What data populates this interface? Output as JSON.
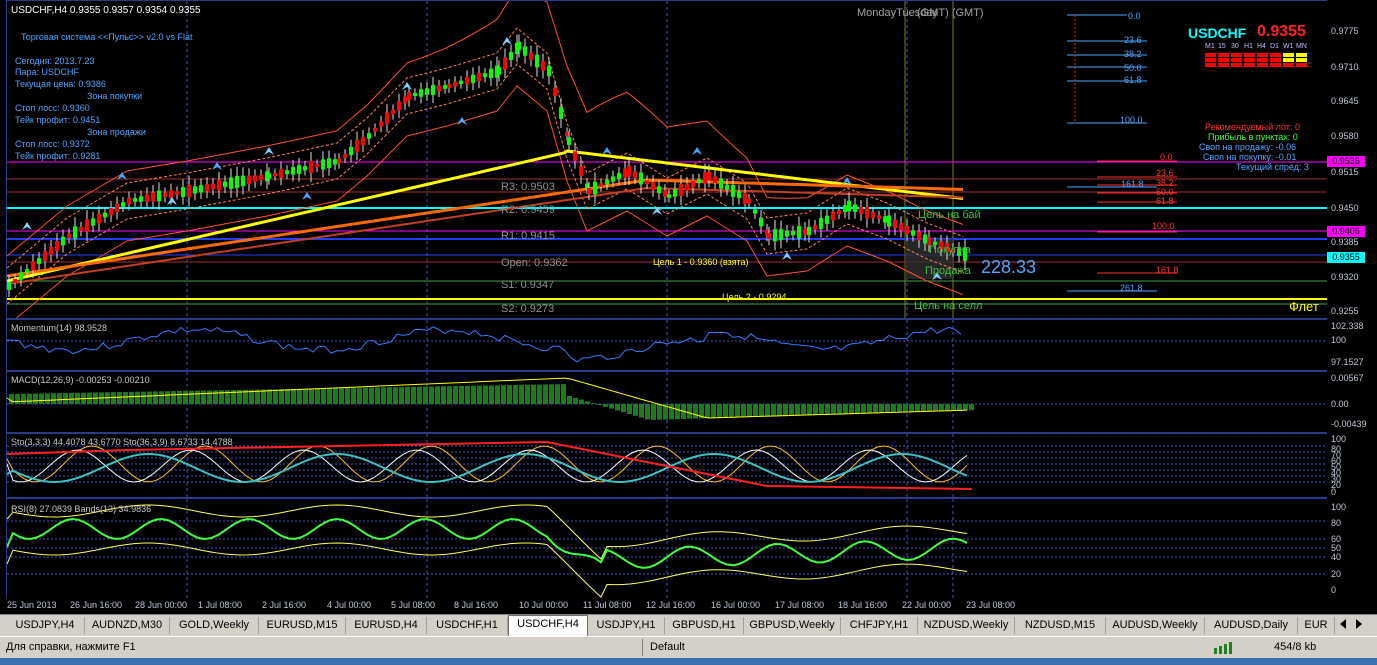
{
  "chart": {
    "header": "USDCHF,H4  0.9355 0.9357 0.9354 0.9355",
    "day_label": "MondayTuesday",
    "gmt_label": "(GMT)  (GMT)",
    "symbol": "USDCHF",
    "price": "0.9355",
    "timeframes": [
      "M1",
      "15",
      "30",
      "H1",
      "H4",
      "D1",
      "W1",
      "MN"
    ],
    "info_panel": {
      "title": "Торговая система <<Пульс>> v2.0 vs Flat",
      "lines": [
        "Сегодня:  2013.7.23",
        "Пара:  USDCHF",
        "Текущая цена: 0.9386",
        "Зона покупки",
        "Стоп лосс:  0.9360",
        "Тейк профит:  0.9451",
        "Зона продажи",
        "Стоп лосс:  0.9372",
        "Тейк профит:  0.9281"
      ]
    },
    "right_info": [
      "Рекомендуемый лот: 0",
      "Прибыль в пунктах: 0",
      "Своп на продажу: -0.06",
      "Своп на покупку: -0.01",
      "Текущий спред: 3"
    ],
    "pivots": [
      "R3: 0.9503",
      "R2: 0.9459",
      "R1: 0.9415",
      "Open: 0.9362",
      "S1: 0.9347",
      "S2: 0.9273"
    ],
    "targets": [
      "Цель 1 - 0.9360 (взята)",
      "Цель 2 - 0.9294"
    ],
    "zone_labels": [
      "Цель на бай",
      "Покупка",
      "Продажа",
      "Цель на селл"
    ],
    "big_number": "228.33",
    "flat_label": "Флет",
    "fib_top": [
      "0.0",
      "23.6",
      "38.2",
      "50.0",
      "61.8",
      "100.0"
    ],
    "fib_mid": [
      "0.0",
      "23.6",
      "38.2",
      "50.0",
      "61.8",
      "100.0",
      "161.8",
      "261.8",
      "161.8"
    ],
    "price_scale": [
      "0.9775",
      "0.9710",
      "0.9645",
      "0.9580",
      "0.9515",
      "0.9450",
      "0.9385",
      "0.9320",
      "0.9255"
    ],
    "price_tags": [
      {
        "v": "0.9536",
        "c": "#ff00ff"
      },
      {
        "v": "0.9406",
        "c": "#ff00ff"
      },
      {
        "v": "0.9355",
        "c": "#00ffff"
      }
    ],
    "colors": {
      "bull": "#00ff00",
      "bear": "#ff0000",
      "ma_yellow": "#ffff00",
      "ma_orange": "#ff6a00",
      "grid": "#2a3a88"
    }
  },
  "indicators": {
    "momentum": {
      "label": "Momentum(14) 98.9528",
      "scale": [
        "102.338",
        "100",
        "97.1527"
      ]
    },
    "macd": {
      "label": "MACD(12,26,9) -0.00253 -0.00210",
      "scale": [
        "0.00567",
        "0.00",
        "-0.00439"
      ]
    },
    "stoch": {
      "label": "Sto(3,3,3) 44.4078 43.6770  Sto(36,3,9) 8.6733 14.4788",
      "scale": [
        "100",
        "80",
        "70",
        "60",
        "50",
        "40",
        "30",
        "20",
        "0"
      ]
    },
    "rsi": {
      "label": "RSI(8) 27.0839  Bands(13) 34.9836",
      "scale": [
        "100",
        "80",
        "60",
        "50",
        "40",
        "20",
        "0"
      ]
    }
  },
  "time_axis": [
    "25 Jun 2013",
    "26 Jun 16:00",
    "28 Jun 00:00",
    "1 Jul 08:00",
    "2 Jul 16:00",
    "4 Jul 00:00",
    "5 Jul 08:00",
    "8 Jul 16:00",
    "10 Jul 00:00",
    "11 Jul 08:00",
    "12 Jul 16:00",
    "16 Jul 00:00",
    "17 Jul 08:00",
    "18 Jul 16:00",
    "22 Jul 00:00",
    "23 Jul 08:00"
  ],
  "tabs": [
    "USDJPY,H4",
    "AUDNZD,M30",
    "GOLD,Weekly",
    "EURUSD,M15",
    "EURUSD,H4",
    "USDCHF,H1",
    "USDCHF,H4",
    "USDJPY,H1",
    "GBPUSD,H1",
    "GBPUSD,Weekly",
    "CHFJPY,H1",
    "NZDUSD,Weekly",
    "NZDUSD,M15",
    "AUDUSD,Weekly",
    "AUDUSD,Daily",
    "EUR"
  ],
  "active_tab": 6,
  "status": {
    "help": "Для справки, нажмите F1",
    "profile": "Default",
    "traffic": "454/8 kb"
  }
}
